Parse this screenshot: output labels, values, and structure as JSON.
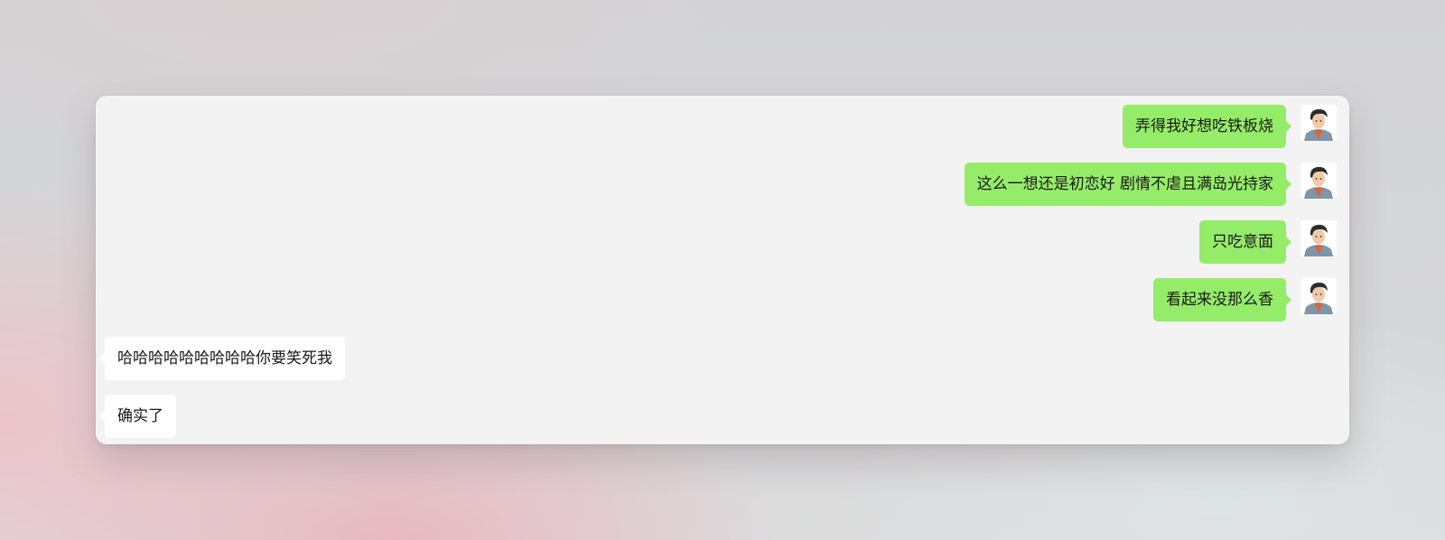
{
  "chat": {
    "messages": [
      {
        "side": "right",
        "text": "弄得我好想吃铁板烧",
        "avatar": "user-avatar"
      },
      {
        "side": "right",
        "text": "这么一想还是初恋好 剧情不虐且满岛光持家",
        "avatar": "user-avatar"
      },
      {
        "side": "right",
        "text": "只吃意面",
        "avatar": "user-avatar"
      },
      {
        "side": "right",
        "text": "看起来没那么香",
        "avatar": "user-avatar"
      },
      {
        "side": "left",
        "text": "哈哈哈哈哈哈哈哈哈你要笑死我"
      },
      {
        "side": "left",
        "text": "确实了"
      }
    ]
  },
  "colors": {
    "sent_bubble": "#95ec69",
    "received_bubble": "#ffffff",
    "window_background": "#f3f3f3"
  }
}
